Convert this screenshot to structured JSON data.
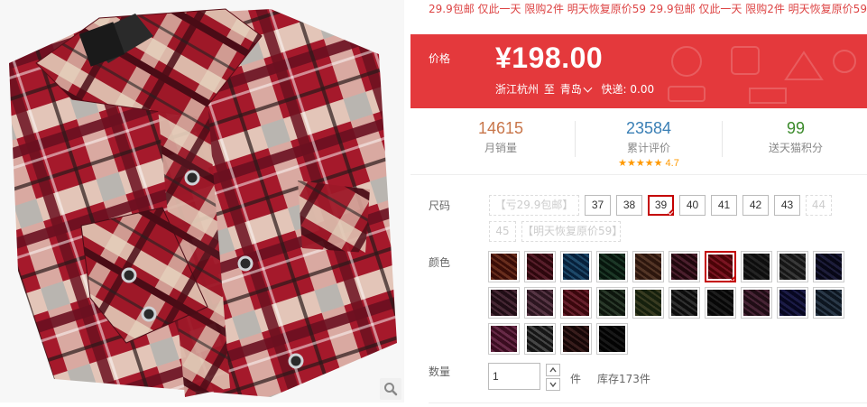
{
  "promo_text": "29.9包邮 仅此一天 限购2件 明天恢复原价59 29.9包邮 仅此一天 限购2件 明天恢复原价59",
  "price": {
    "label": "价格",
    "value": "¥198.00",
    "origin": "浙江杭州",
    "to": "至",
    "destination": "青岛",
    "shipping": "快递: 0.00"
  },
  "stats": {
    "monthly_sales": {
      "value": "14615",
      "label": "月销量",
      "color": "#c8764a"
    },
    "total_reviews": {
      "value": "23584",
      "label": "累计评价",
      "color": "#3a7fb5",
      "stars": "★★★★★",
      "score": "4.7"
    },
    "points": {
      "value": "99",
      "label": "送天猫积分",
      "color": "#3a8a2a"
    }
  },
  "size": {
    "label": "尺码",
    "options": [
      {
        "text": "【亏29.9包邮】",
        "state": "disabled"
      },
      {
        "text": "37",
        "state": "normal"
      },
      {
        "text": "38",
        "state": "normal"
      },
      {
        "text": "39",
        "state": "selected"
      },
      {
        "text": "40",
        "state": "normal"
      },
      {
        "text": "41",
        "state": "normal"
      },
      {
        "text": "42",
        "state": "normal"
      },
      {
        "text": "43",
        "state": "normal"
      },
      {
        "text": "44",
        "state": "disabled"
      },
      {
        "text": "45",
        "state": "disabled"
      },
      {
        "text": "【明天恢复原价59】",
        "state": "disabled"
      }
    ]
  },
  "color": {
    "label": "颜色",
    "swatches": [
      {
        "c1": "#7a3a2a",
        "c2": "#d9c4b0",
        "selected": false
      },
      {
        "c1": "#6b2a3a",
        "c2": "#cfb7b7",
        "selected": false
      },
      {
        "c1": "#2a5a7a",
        "c2": "#b8d0dc",
        "selected": false
      },
      {
        "c1": "#2a4a3a",
        "c2": "#a8bca8",
        "selected": false
      },
      {
        "c1": "#6a4a3a",
        "c2": "#c8b8a8",
        "selected": false
      },
      {
        "c1": "#5a2a3a",
        "c2": "#d4bcc4",
        "selected": false
      },
      {
        "c1": "#8a1a2a",
        "c2": "#e0c8c8",
        "selected": true
      },
      {
        "c1": "#3a3a3a",
        "c2": "#a0a0a0",
        "selected": false
      },
      {
        "c1": "#4a4a4a",
        "c2": "#c0c0c0",
        "selected": false
      },
      {
        "c1": "#2a2a4a",
        "c2": "#b0b0c8",
        "selected": false
      },
      {
        "c1": "#5a3a4a",
        "c2": "#c8b0b8",
        "selected": false
      },
      {
        "c1": "#6a4a5a",
        "c2": "#d0b8c0",
        "selected": false
      },
      {
        "c1": "#7a2a3a",
        "c2": "#d8c0c0",
        "selected": false
      },
      {
        "c1": "#3a4a3a",
        "c2": "#b8c4b8",
        "selected": false
      },
      {
        "c1": "#4a5a3a",
        "c2": "#c0a890",
        "selected": false
      },
      {
        "c1": "#3a3a3a",
        "c2": "#d8d8d8",
        "selected": false
      },
      {
        "c1": "#2a2a2a",
        "c2": "#b8b8b8",
        "selected": false
      },
      {
        "c1": "#5a3a4a",
        "c2": "#c8a0b8",
        "selected": false
      },
      {
        "c1": "#2a2a5a",
        "c2": "#a8a8c8",
        "selected": false
      },
      {
        "c1": "#3a4a5a",
        "c2": "#b8c0cc",
        "selected": false
      },
      {
        "c1": "#7a3a5a",
        "c2": "#d8b8c8",
        "selected": false
      },
      {
        "c1": "#4a4a4a",
        "c2": "#f0f0f0",
        "selected": false
      },
      {
        "c1": "#4a2a2a",
        "c2": "#c0b0a8",
        "selected": false
      },
      {
        "c1": "#1a1a1a",
        "c2": "#e8e8e8",
        "selected": false
      }
    ]
  },
  "quantity": {
    "label": "数量",
    "value": "1",
    "unit": "件",
    "stock": "库存173件"
  }
}
